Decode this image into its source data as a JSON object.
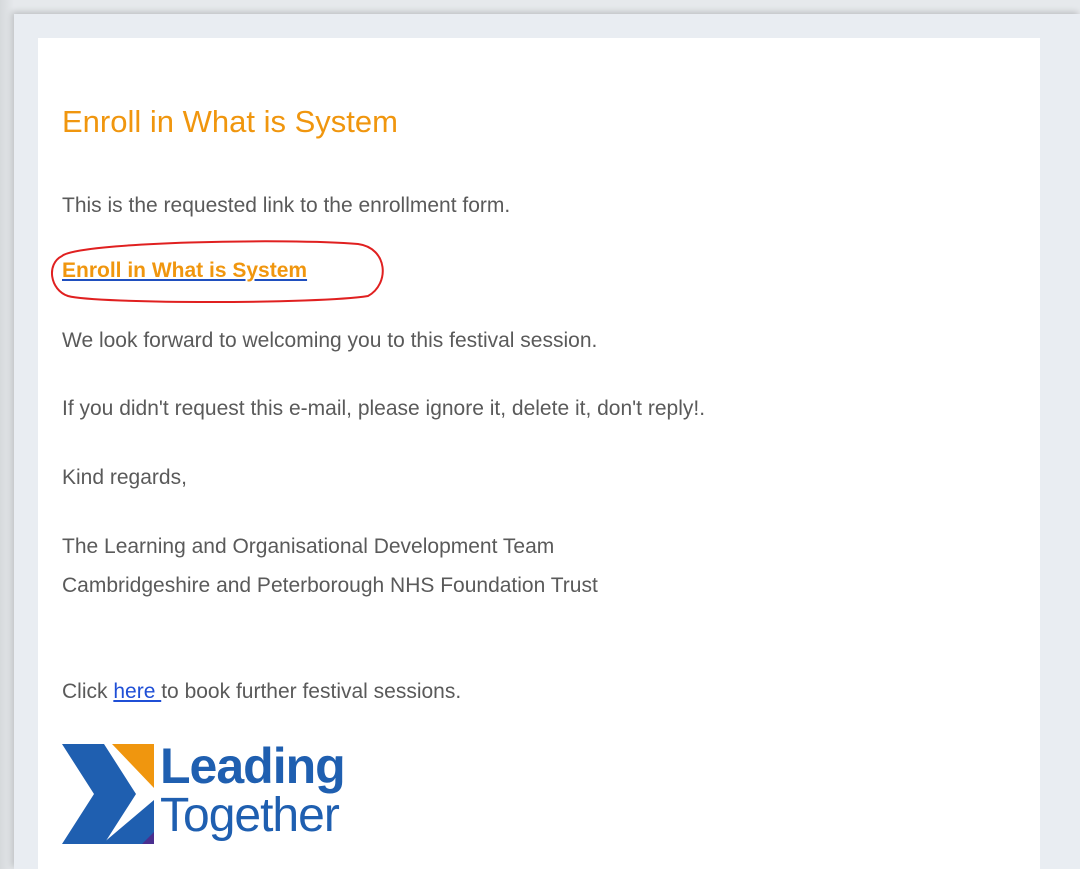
{
  "email": {
    "title": "Enroll in What is System",
    "intro": "This is the requested link to the enrollment form.",
    "enroll_link_label": "Enroll in What is System",
    "welcome": "We look forward to welcoming you to this festival session.",
    "ignore_notice": "If you didn't request this e-mail, please ignore it, delete it, don't reply!.",
    "closing": "Kind regards,",
    "signature_team": "The Learning and Organisational Development Team",
    "signature_org": "Cambridgeshire and Peterborough NHS Foundation Trust",
    "footer_prefix": "Click ",
    "footer_link_label": "here ",
    "footer_suffix": "to book further festival sessions."
  },
  "logo": {
    "line1": "Leading",
    "line2": "Together"
  },
  "colors": {
    "title": "#f0960e",
    "body_text": "#5a5a5a",
    "link_blue": "#1f4fd6",
    "highlight": "#e02020",
    "logo_blue": "#1f5fb0",
    "logo_orange": "#f0960e",
    "logo_purple": "#4a2f8f"
  }
}
